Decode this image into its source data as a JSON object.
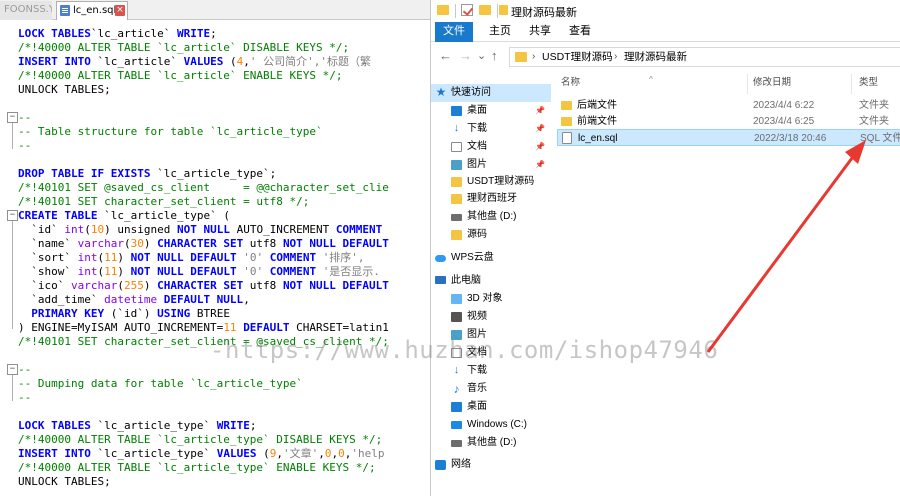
{
  "editor": {
    "tabs": [
      {
        "label": "FOONSS.YUM"
      },
      {
        "label": "lc_en.sql",
        "close": "×"
      }
    ],
    "code_lines": [
      [
        [
          "kw",
          "LOCK TABLES"
        ],
        [
          "",
          "`lc_article`"
        ],
        [
          "kw",
          " WRITE"
        ],
        [
          "",
          ";"
        ]
      ],
      [
        [
          "cm",
          "/*!40000 ALTER TABLE `lc_article` DISABLE KEYS */;"
        ]
      ],
      [
        [
          "kw",
          "INSERT INTO"
        ],
        [
          "",
          " `lc_article` "
        ],
        [
          "kw",
          "VALUES"
        ],
        [
          "",
          " ("
        ],
        [
          "num",
          "4"
        ],
        [
          "",
          ","
        ],
        [
          "st",
          "' 公司简介','标题（繁"
        ]
      ],
      [
        [
          "cm",
          "/*!40000 ALTER TABLE `lc_article` ENABLE KEYS */;"
        ]
      ],
      [
        [
          "",
          "UNLOCK TABLES;"
        ]
      ],
      [
        [
          "",
          ""
        ]
      ],
      [
        [
          "cm",
          "--"
        ]
      ],
      [
        [
          "cm",
          "-- Table structure for table `lc_article_type`"
        ]
      ],
      [
        [
          "cm",
          "--"
        ]
      ],
      [
        [
          "",
          ""
        ]
      ],
      [
        [
          "kw",
          "DROP TABLE IF EXISTS"
        ],
        [
          "",
          " `lc_article_type`;"
        ]
      ],
      [
        [
          "cm",
          "/*!40101 SET @saved_cs_client     = @@character_set_clie"
        ]
      ],
      [
        [
          "cm",
          "/*!40101 SET character_set_client = utf8 */;"
        ]
      ],
      [
        [
          "kw",
          "CREATE TABLE"
        ],
        [
          "",
          " `lc_article_type` ("
        ]
      ],
      [
        [
          "",
          "  `id` "
        ],
        [
          "ty",
          "int"
        ],
        [
          "",
          "("
        ],
        [
          "num",
          "10"
        ],
        [
          "",
          ") unsigned "
        ],
        [
          "kw",
          "NOT NULL"
        ],
        [
          "",
          " AUTO_INCREMENT "
        ],
        [
          "kw",
          "COMMENT"
        ]
      ],
      [
        [
          "",
          "  `name` "
        ],
        [
          "ty",
          "varchar"
        ],
        [
          "",
          "("
        ],
        [
          "num",
          "30"
        ],
        [
          "",
          ") "
        ],
        [
          "kw",
          "CHARACTER SET"
        ],
        [
          "",
          " utf8 "
        ],
        [
          "kw",
          "NOT NULL DEFAULT"
        ]
      ],
      [
        [
          "",
          "  `sort` "
        ],
        [
          "ty",
          "int"
        ],
        [
          "",
          "("
        ],
        [
          "num",
          "11"
        ],
        [
          "",
          ") "
        ],
        [
          "kw",
          "NOT NULL DEFAULT"
        ],
        [
          "",
          " "
        ],
        [
          "st",
          "'0'"
        ],
        [
          "",
          " "
        ],
        [
          "kw",
          "COMMENT"
        ],
        [
          "",
          " "
        ],
        [
          "st",
          "'排序',"
        ]
      ],
      [
        [
          "",
          "  `show` "
        ],
        [
          "ty",
          "int"
        ],
        [
          "",
          "("
        ],
        [
          "num",
          "11"
        ],
        [
          "",
          ") "
        ],
        [
          "kw",
          "NOT NULL DEFAULT"
        ],
        [
          "",
          " "
        ],
        [
          "st",
          "'0'"
        ],
        [
          "",
          " "
        ],
        [
          "kw",
          "COMMENT"
        ],
        [
          "",
          " "
        ],
        [
          "st",
          "'是否显示."
        ]
      ],
      [
        [
          "",
          "  `ico` "
        ],
        [
          "ty",
          "varchar"
        ],
        [
          "",
          "("
        ],
        [
          "num",
          "255"
        ],
        [
          "",
          ") "
        ],
        [
          "kw",
          "CHARACTER SET"
        ],
        [
          "",
          " utf8 "
        ],
        [
          "kw",
          "NOT NULL DEFAULT"
        ]
      ],
      [
        [
          "",
          "  `add_time` "
        ],
        [
          "ty",
          "datetime"
        ],
        [
          "",
          " "
        ],
        [
          "kw",
          "DEFAULT NULL"
        ],
        [
          "",
          ","
        ]
      ],
      [
        [
          "",
          "  "
        ],
        [
          "kw",
          "PRIMARY KEY"
        ],
        [
          "",
          " (`id`) "
        ],
        [
          "kw",
          "USING"
        ],
        [
          "",
          " BTREE"
        ]
      ],
      [
        [
          "",
          ") ENGINE=MyISAM AUTO_INCREMENT="
        ],
        [
          "num",
          "11"
        ],
        [
          "",
          " "
        ],
        [
          "kw",
          "DEFAULT"
        ],
        [
          "",
          " CHARSET=latin1"
        ]
      ],
      [
        [
          "cm",
          "/*!40101 SET character_set_client = @saved_cs_client */;"
        ]
      ],
      [
        [
          "",
          ""
        ]
      ],
      [
        [
          "cm",
          "--"
        ]
      ],
      [
        [
          "cm",
          "-- Dumping data for table `lc_article_type`"
        ]
      ],
      [
        [
          "cm",
          "--"
        ]
      ],
      [
        [
          "",
          ""
        ]
      ],
      [
        [
          "kw",
          "LOCK TABLES"
        ],
        [
          "",
          " `lc_article_type` "
        ],
        [
          "kw",
          "WRITE"
        ],
        [
          "",
          ";"
        ]
      ],
      [
        [
          "cm",
          "/*!40000 ALTER TABLE `lc_article_type` DISABLE KEYS */;"
        ]
      ],
      [
        [
          "kw",
          "INSERT INTO"
        ],
        [
          "",
          " `lc_article_type` "
        ],
        [
          "kw",
          "VALUES"
        ],
        [
          "",
          " ("
        ],
        [
          "num",
          "9"
        ],
        [
          "",
          ","
        ],
        [
          "st",
          "'文章'"
        ],
        [
          "",
          ","
        ],
        [
          "num",
          "0"
        ],
        [
          "",
          ","
        ],
        [
          "num",
          "0"
        ],
        [
          "",
          ","
        ],
        [
          "st",
          "'help"
        ]
      ],
      [
        [
          "cm",
          "/*!40000 ALTER TABLE `lc_article_type` ENABLE KEYS */;"
        ]
      ],
      [
        [
          "",
          "UNLOCK TABLES;"
        ]
      ]
    ]
  },
  "explorer": {
    "title": "理财源码最新",
    "ribbon_tabs": [
      "文件",
      "主页",
      "共享",
      "查看"
    ],
    "nav_buttons": {
      "back": "←",
      "forward": "→",
      "recent": "⌄",
      "up": "↑"
    },
    "breadcrumb": [
      "USDT理财源码",
      "理财源码最新"
    ],
    "breadcrumb_sep": "›",
    "nav_items": [
      {
        "label": "快速访问",
        "icon": "star-icon"
      },
      {
        "label": "桌面",
        "icon": "desktop-icon",
        "pin": "📌"
      },
      {
        "label": "下载",
        "icon": "download-icon",
        "pin": "📌"
      },
      {
        "label": "文档",
        "icon": "document-icon",
        "pin": "📌"
      },
      {
        "label": "图片",
        "icon": "picture-icon",
        "pin": "📌"
      },
      {
        "label": "USDT理财源码",
        "icon": "folder-icon"
      },
      {
        "label": "理财西班牙",
        "icon": "folder-icon"
      },
      {
        "label": "其他盘 (D:)",
        "icon": "drive-icon"
      },
      {
        "label": "源码",
        "icon": "folder-icon"
      },
      {
        "label": "WPS云盘",
        "icon": "cloud-icon"
      },
      {
        "label": "此电脑",
        "icon": "computer-icon"
      },
      {
        "label": "3D 对象",
        "icon": "cube-icon"
      },
      {
        "label": "视频",
        "icon": "video-icon"
      },
      {
        "label": "图片",
        "icon": "picture-icon"
      },
      {
        "label": "文档",
        "icon": "document-icon"
      },
      {
        "label": "下载",
        "icon": "download-icon"
      },
      {
        "label": "音乐",
        "icon": "music-icon"
      },
      {
        "label": "桌面",
        "icon": "desktop-icon"
      },
      {
        "label": "Windows (C:)",
        "icon": "windows-drive-icon"
      },
      {
        "label": "其他盘 (D:)",
        "icon": "drive-icon"
      },
      {
        "label": "网络",
        "icon": "network-icon"
      }
    ],
    "columns": {
      "name": "名称",
      "date": "修改日期",
      "type": "类型",
      "sort_indicator": "^"
    },
    "files": [
      {
        "name": "后端文件",
        "date": "2023/4/4 6:22",
        "type": "文件夹",
        "kind": "folder"
      },
      {
        "name": "前端文件",
        "date": "2023/4/4 6:25",
        "type": "文件夹",
        "kind": "folder"
      },
      {
        "name": "lc_en.sql",
        "date": "2022/3/18 20:46",
        "type": "SQL 文件",
        "kind": "file"
      }
    ]
  },
  "watermark": "-https://www.huzhan.com/ishop47946",
  "colors": {
    "accent": "#1979ca",
    "selection": "#cce8ff",
    "arrow": "#e8382f"
  }
}
